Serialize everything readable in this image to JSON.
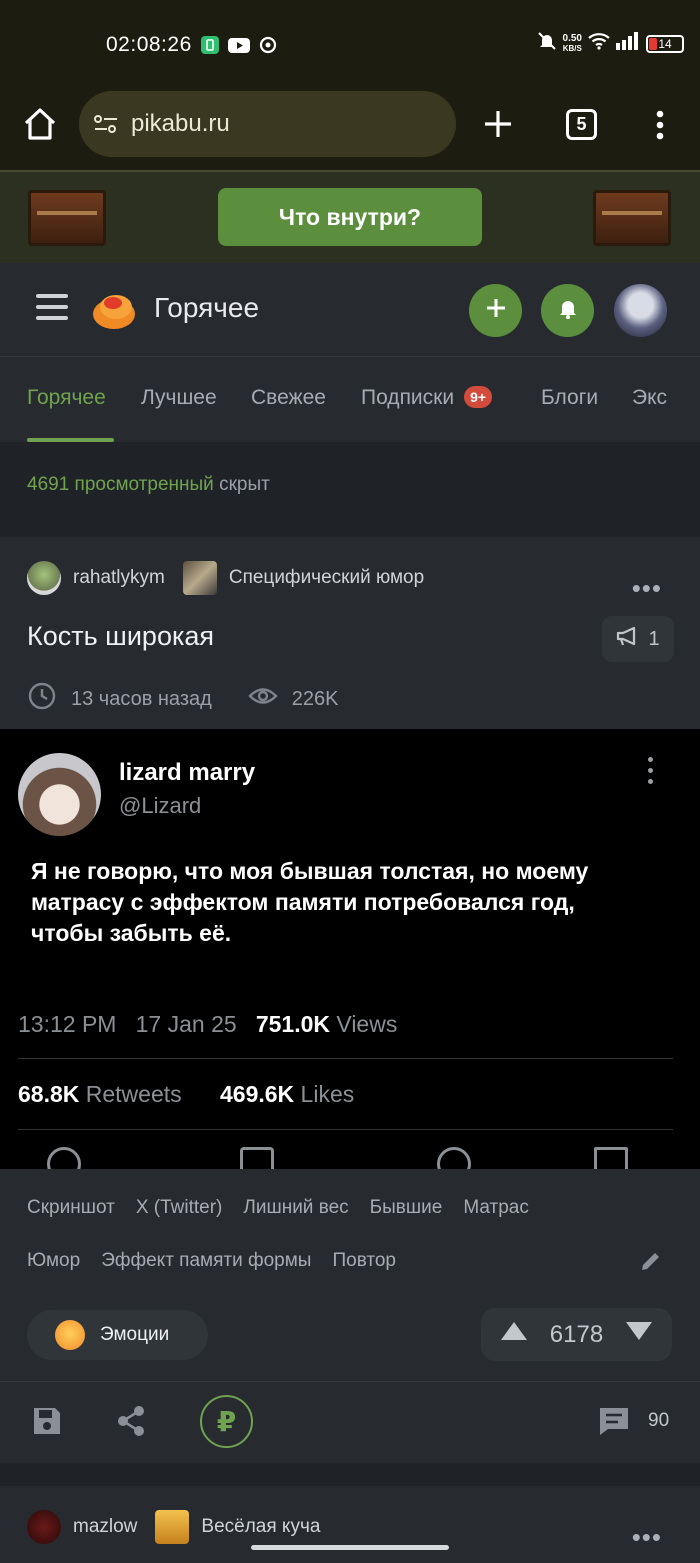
{
  "status_bar": {
    "time": "02:08:26",
    "net_speed_value": "0.50",
    "net_speed_unit": "KB/S",
    "battery": "14"
  },
  "browser": {
    "url": "pikabu.ru",
    "tab_count": "5"
  },
  "promo": {
    "button_label": "Что внутри?"
  },
  "header": {
    "title": "Горячее",
    "accent_color": "#5b8f3d"
  },
  "tabs": [
    {
      "label": "Горячее",
      "active": true
    },
    {
      "label": "Лучшее"
    },
    {
      "label": "Свежее"
    },
    {
      "label": "Подписки",
      "badge": "9+"
    },
    {
      "label": "Блоги"
    },
    {
      "label": "Экс"
    }
  ],
  "notice": {
    "count_text": "4691 просмотренный",
    "suffix": "скрыт"
  },
  "post": {
    "author": "rahatlykym",
    "community": "Специфический юмор",
    "title": "Кость широкая",
    "replies": "1",
    "time_ago": "13 часов назад",
    "views": "226K",
    "tweet": {
      "name": "lizard marry",
      "handle": "@Lizard",
      "text": "Я не говорю, что моя бывшая толстая, но моему матрасу с эффектом памяти потребовался год, чтобы забыть её.",
      "time": "13:12 PM",
      "date": "17 Jan 25",
      "views_count": "751.0K",
      "views_label": "Views",
      "retweets_count": "68.8K",
      "retweets_label": "Retweets",
      "likes_count": "469.6K",
      "likes_label": "Likes"
    },
    "tags_line1": [
      "Скриншот",
      "X (Twitter)",
      "Лишний вес",
      "Бывшие",
      "Матрас"
    ],
    "tags_line2": [
      "Юмор",
      "Эффект памяти формы",
      "Повтор"
    ],
    "emotions_label": "Эмоции",
    "rating": "6178",
    "comments": "90"
  },
  "next_post": {
    "author": "mazlow",
    "community": "Весёлая куча"
  }
}
